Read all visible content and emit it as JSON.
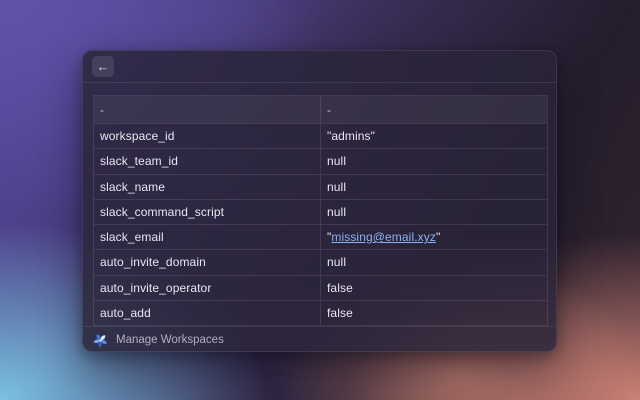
{
  "window": {
    "titlebar": {
      "back_icon": "←"
    },
    "table": {
      "header": {
        "col1": "-",
        "col2": "-"
      },
      "rows": [
        {
          "key": "workspace_id",
          "value": "\"admins\""
        },
        {
          "key": "slack_team_id",
          "value": "null"
        },
        {
          "key": "slack_name",
          "value": "null"
        },
        {
          "key": "slack_command_script",
          "value": "null"
        },
        {
          "key": "slack_email",
          "prefix": "\"",
          "link_text": "missing@email.xyz",
          "suffix": "\""
        },
        {
          "key": "auto_invite_domain",
          "value": "null"
        },
        {
          "key": "auto_invite_operator",
          "value": "false"
        },
        {
          "key": "auto_add",
          "value": "false"
        }
      ]
    },
    "footer": {
      "label": "Manage Workspaces"
    }
  },
  "colors": {
    "link": "#8ab4f8",
    "bg_top_left": "#6153aa",
    "bg_top_right": "#241d2c",
    "bg_bottom_left": "#7ac2e0",
    "bg_bottom_right": "#cc8175",
    "window_tint": "rgba(42,36,58,0.85)"
  }
}
